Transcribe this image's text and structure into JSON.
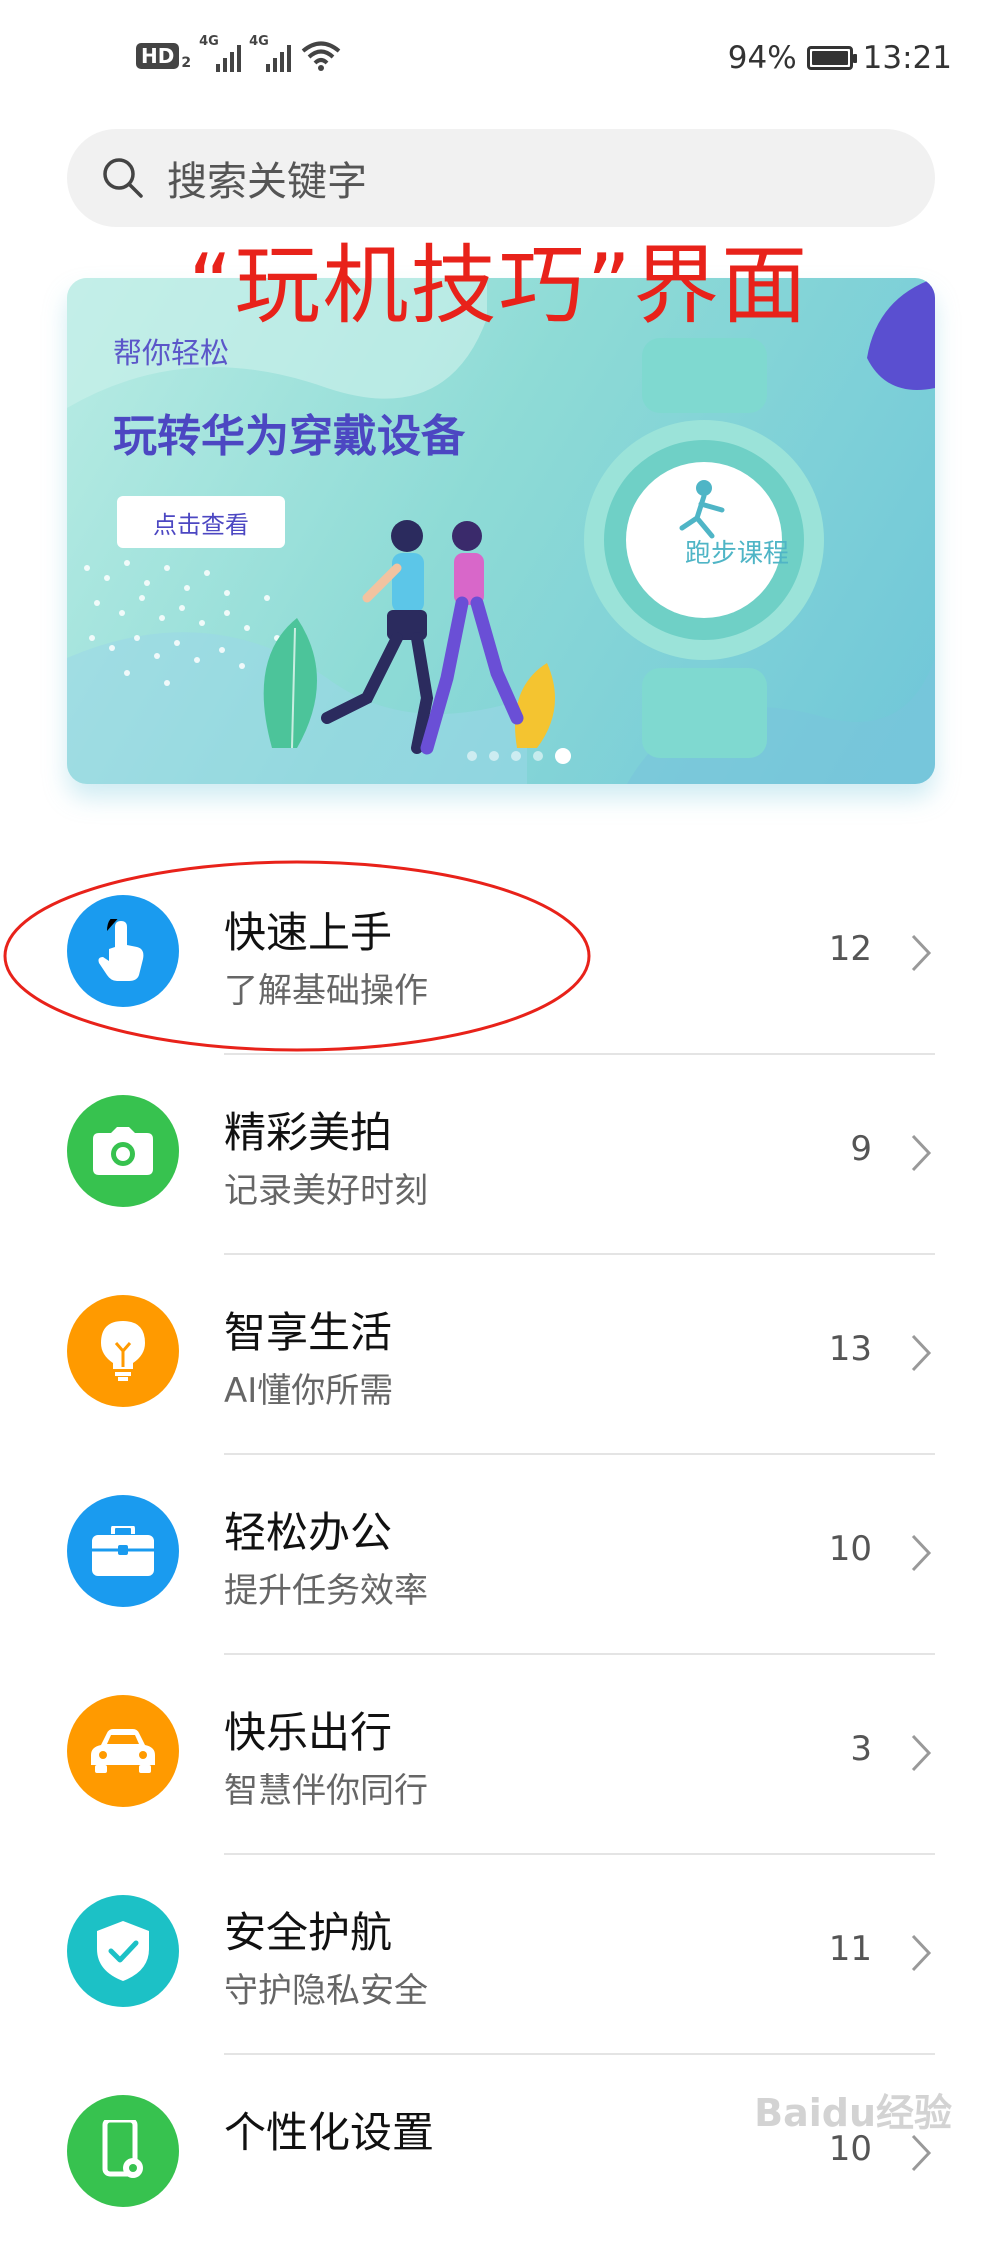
{
  "status_bar": {
    "hd_label": "HD",
    "hd_sub": "2",
    "net1": "4G",
    "net2": "4G",
    "battery_percent": "94%",
    "time": "13:21"
  },
  "search": {
    "placeholder": "搜索关键字"
  },
  "annotation": "“玩机技巧”界面",
  "banner": {
    "subtitle": "帮你轻松",
    "title": "玩转华为穿戴设备",
    "button_label": "点击查看",
    "watch_label": "跑步课程",
    "page_count": 5,
    "active_page": 5
  },
  "list": [
    {
      "title": "快速上手",
      "subtitle": "了解基础操作",
      "count": "12",
      "icon": "touch-hand-icon",
      "color": "#1a9bef"
    },
    {
      "title": "精彩美拍",
      "subtitle": "记录美好时刻",
      "count": "9",
      "icon": "camera-icon",
      "color": "#37c24f"
    },
    {
      "title": "智享生活",
      "subtitle": "AI懂你所需",
      "count": "13",
      "icon": "lightbulb-icon",
      "color": "#ff9a00"
    },
    {
      "title": "轻松办公",
      "subtitle": "提升任务效率",
      "count": "10",
      "icon": "briefcase-icon",
      "color": "#1a9bef"
    },
    {
      "title": "快乐出行",
      "subtitle": "智慧伴你同行",
      "count": "3",
      "icon": "car-icon",
      "color": "#ff9a00"
    },
    {
      "title": "安全护航",
      "subtitle": "守护隐私安全",
      "count": "11",
      "icon": "shield-check-icon",
      "color": "#1cc1c6"
    },
    {
      "title": "个性化设置",
      "subtitle": "",
      "count": "10",
      "icon": "phone-settings-icon",
      "color": "#37c24f"
    }
  ],
  "watermark": "Baidu经验"
}
